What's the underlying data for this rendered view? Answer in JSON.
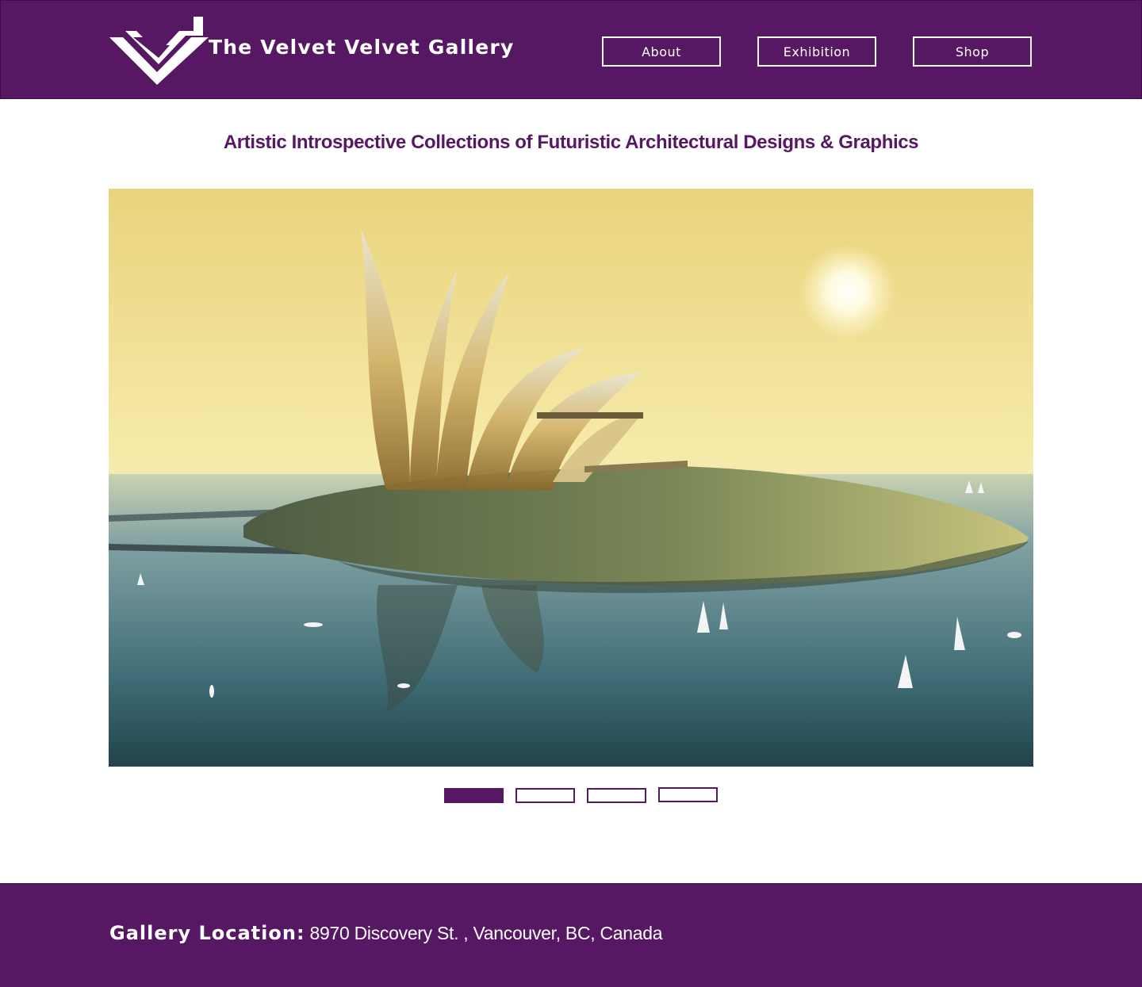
{
  "header": {
    "brand": "The Velvet Velvet Gallery",
    "logo_icon": "velvet-chevron-logo-icon",
    "nav": [
      {
        "label": "About"
      },
      {
        "label": "Exhibition"
      },
      {
        "label": "Shop"
      }
    ]
  },
  "main": {
    "tagline": "Artistic Introspective Collections of Futuristic Architectural Designs & Graphics",
    "carousel": {
      "slide_count": 4,
      "active_index": 0
    }
  },
  "footer": {
    "location_label": "Gallery Location:",
    "address": "8970 Discovery St. , Vancouver, BC, Canada"
  },
  "colors": {
    "brand_purple": "#561862",
    "white": "#ffffff"
  }
}
